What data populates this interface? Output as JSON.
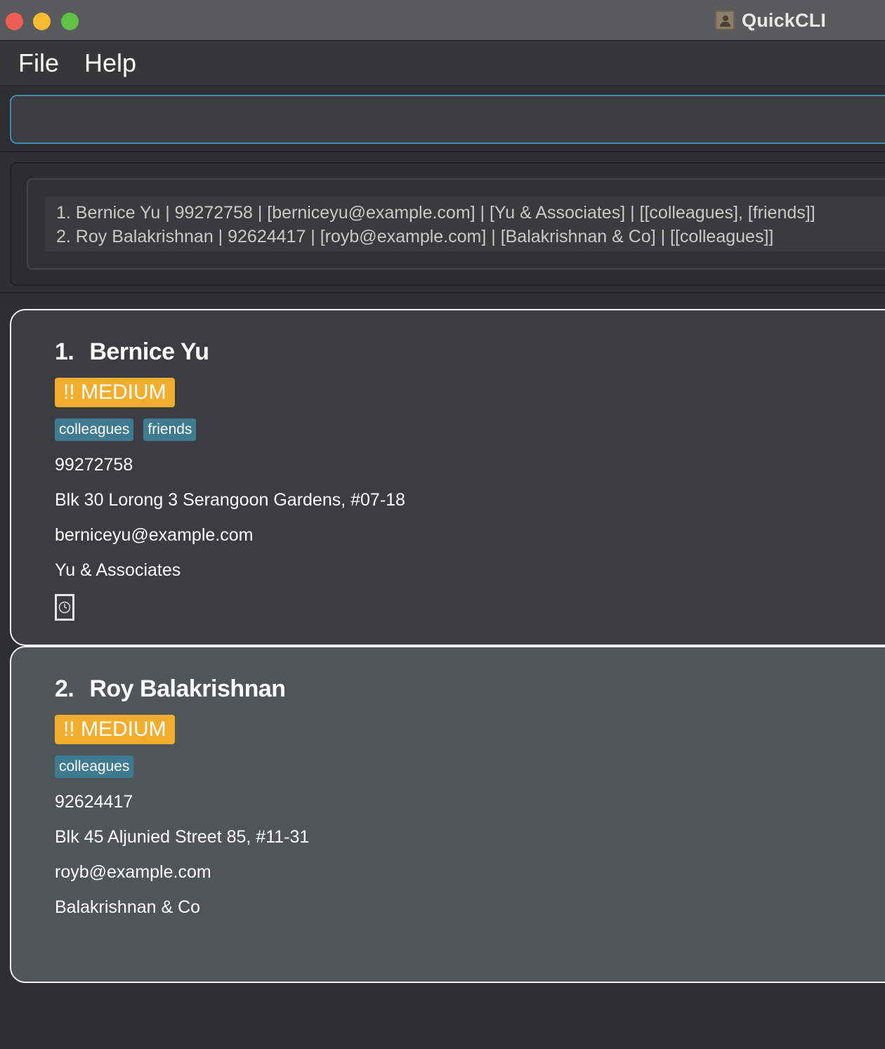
{
  "window": {
    "title": "QuickCLI"
  },
  "menu": {
    "items": [
      {
        "label": "File"
      },
      {
        "label": "Help"
      }
    ]
  },
  "command": {
    "value": "",
    "placeholder": ""
  },
  "result": {
    "lines": [
      "1. Bernice Yu | 99272758 | [berniceyu@example.com] | [Yu & Associates] | [[colleagues], [friends]]",
      "2. Roy Balakrishnan | 92624417 | [royb@example.com] | [Balakrishnan & Co] | [[colleagues]]"
    ]
  },
  "persons": [
    {
      "index": "1.",
      "name": "Bernice Yu",
      "priority": "!! MEDIUM",
      "tags": [
        "colleagues",
        "friends"
      ],
      "phone": "99272758",
      "address": "Blk 30 Lorong 3 Serangoon Gardens, #07-18",
      "email": "berniceyu@example.com",
      "organisation": "Yu & Associates",
      "icon": "clock-icon"
    },
    {
      "index": "2.",
      "name": "Roy Balakrishnan",
      "priority": "!! MEDIUM",
      "tags": [
        "colleagues"
      ],
      "phone": "92624417",
      "address": "Blk 45 Aljunied Street 85, #11-31",
      "email": "royb@example.com",
      "organisation": "Balakrishnan & Co"
    }
  ],
  "colors": {
    "priority_medium": "#f2ac2e",
    "tag": "#3e7b91",
    "command_border": "#3d8ab3",
    "card_selected": "#4f5559",
    "card_default": "#3b3d40"
  }
}
